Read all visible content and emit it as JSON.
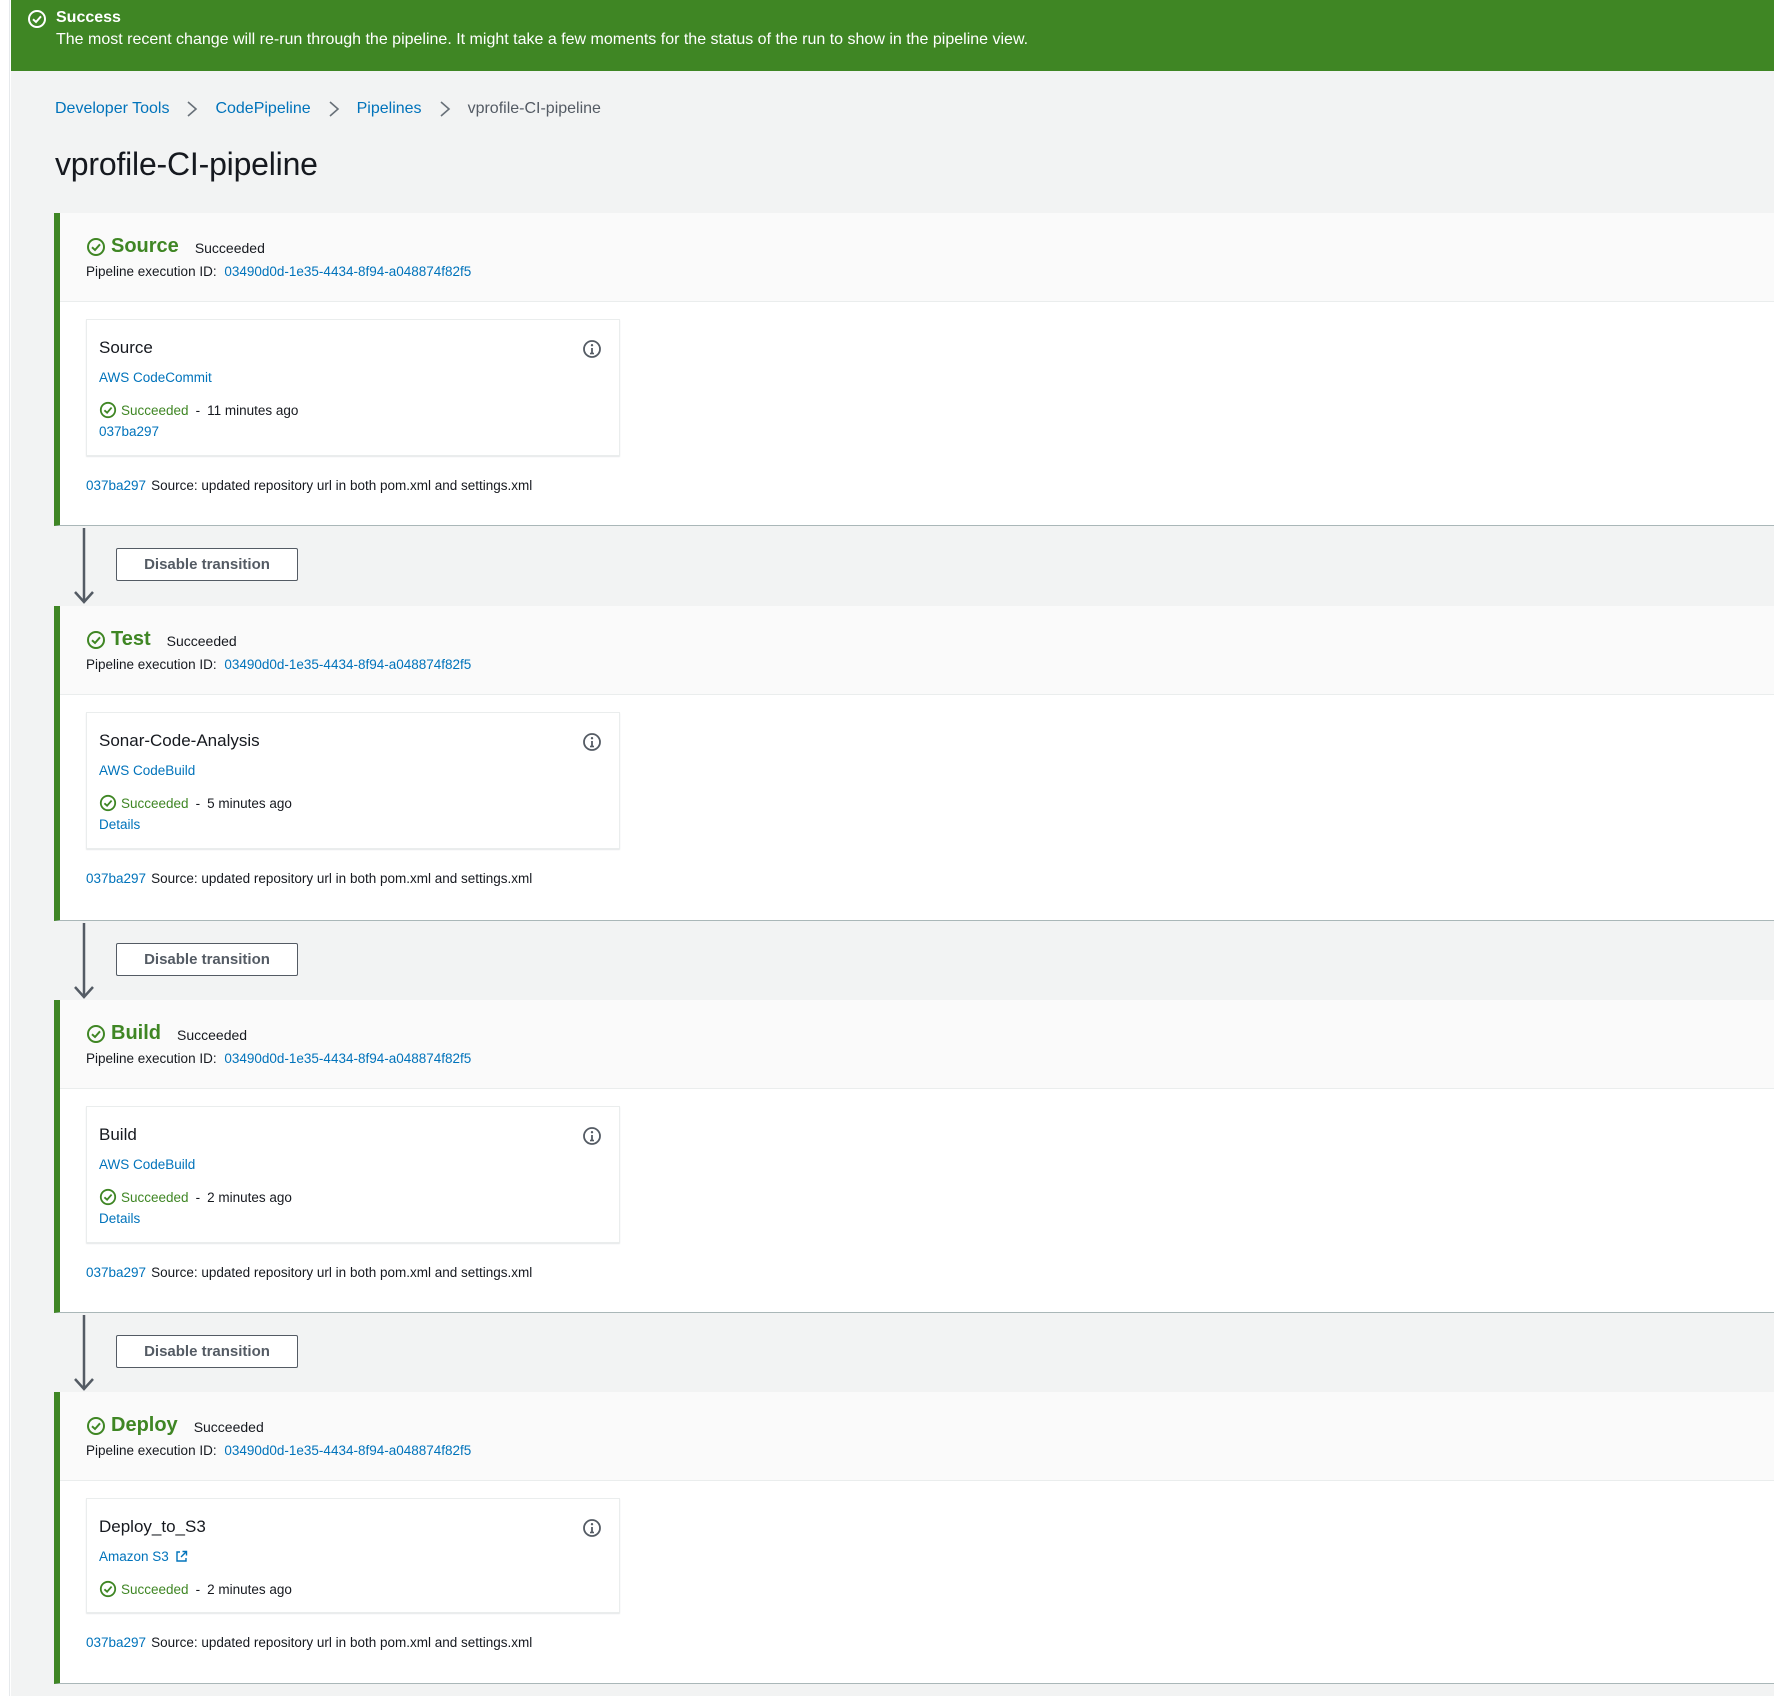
{
  "flash": {
    "title": "Success",
    "message": "The most recent change will re-run through the pipeline. It might take a few moments for the status of the run to show in the pipeline view.",
    "color": "#3f8624",
    "icon": "check-circle-icon"
  },
  "breadcrumb": {
    "items": [
      "Developer Tools",
      "CodePipeline",
      "Pipelines"
    ],
    "current": "vprofile-CI-pipeline",
    "separator_icon": "chevron-right-icon"
  },
  "page_title": "vprofile-CI-pipeline",
  "colors": {
    "success": "#3f8624",
    "link": "#0073bb",
    "background": "#f2f3f3"
  },
  "stages": [
    {
      "name": "Source",
      "status": "Succeeded",
      "exec_label": "Pipeline execution ID:",
      "exec_id": "03490d0d-1e35-4434-8f94-a048874f82f5",
      "action": {
        "name": "Source",
        "provider": "AWS CodeCommit",
        "status": "Succeeded",
        "dash": "-",
        "time": "11 minutes ago",
        "sub_link": "037ba297"
      },
      "revision_id": "037ba297",
      "revision_text": "Source: updated repository url in both pom.xml and settings.xml"
    },
    {
      "name": "Test",
      "status": "Succeeded",
      "exec_label": "Pipeline execution ID:",
      "exec_id": "03490d0d-1e35-4434-8f94-a048874f82f5",
      "action": {
        "name": "Sonar-Code-Analysis",
        "provider": "AWS CodeBuild",
        "status": "Succeeded",
        "dash": "-",
        "time": "5 minutes ago",
        "sub_link": "Details"
      },
      "revision_id": "037ba297",
      "revision_text": "Source: updated repository url in both pom.xml and settings.xml"
    },
    {
      "name": "Build",
      "status": "Succeeded",
      "exec_label": "Pipeline execution ID:",
      "exec_id": "03490d0d-1e35-4434-8f94-a048874f82f5",
      "action": {
        "name": "Build",
        "provider": "AWS CodeBuild",
        "status": "Succeeded",
        "dash": "-",
        "time": "2 minutes ago",
        "sub_link": "Details"
      },
      "revision_id": "037ba297",
      "revision_text": "Source: updated repository url in both pom.xml and settings.xml"
    },
    {
      "name": "Deploy",
      "status": "Succeeded",
      "exec_label": "Pipeline execution ID:",
      "exec_id": "03490d0d-1e35-4434-8f94-a048874f82f5",
      "action": {
        "name": "Deploy_to_S3",
        "provider": "Amazon S3",
        "provider_icon": "external-link-icon",
        "status": "Succeeded",
        "dash": "-",
        "time": "2 minutes ago"
      },
      "revision_id": "037ba297",
      "revision_text": "Source: updated repository url in both pom.xml and settings.xml"
    }
  ],
  "transitions": [
    {
      "button_label": "Disable transition"
    },
    {
      "button_label": "Disable transition"
    },
    {
      "button_label": "Disable transition"
    }
  ]
}
